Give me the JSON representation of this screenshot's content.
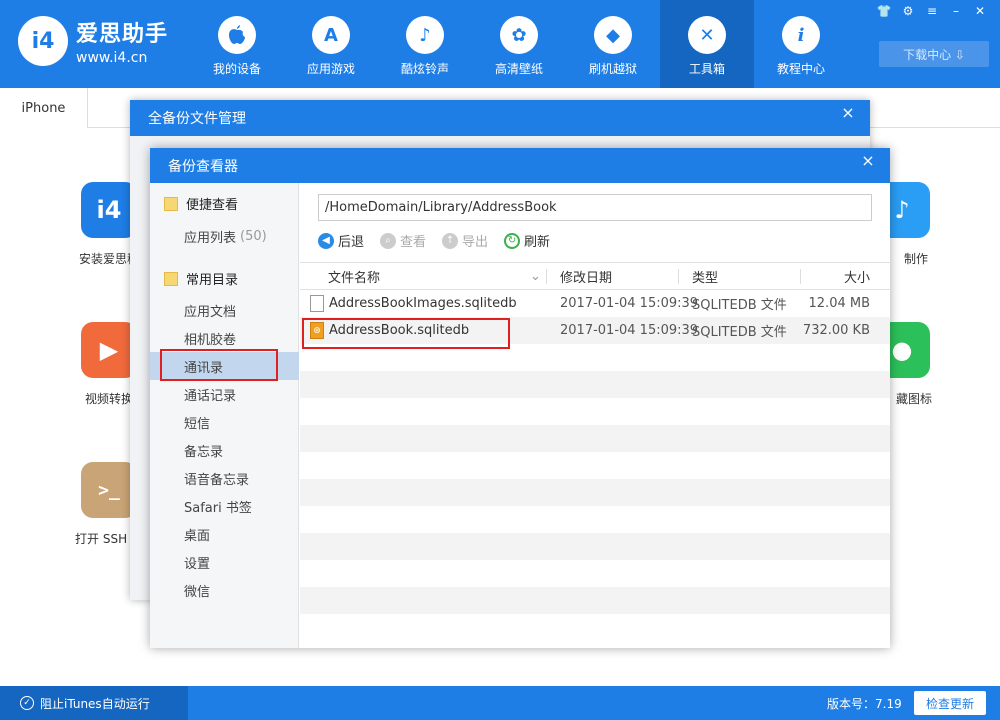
{
  "app": {
    "logo_mark": "i4",
    "logo_name": "爱思助手",
    "logo_url": "www.i4.cn"
  },
  "nav": [
    {
      "label": "我的设备",
      "icon": "apple-icon",
      "glyph": ""
    },
    {
      "label": "应用游戏",
      "icon": "appstore-icon",
      "glyph": "A"
    },
    {
      "label": "酷炫铃声",
      "icon": "bell-icon",
      "glyph": "♪"
    },
    {
      "label": "高清壁纸",
      "icon": "flower-icon",
      "glyph": "✿"
    },
    {
      "label": "刷机越狱",
      "icon": "box-icon",
      "glyph": "◆"
    },
    {
      "label": "工具箱",
      "icon": "tools-icon",
      "glyph": "✕"
    },
    {
      "label": "教程中心",
      "icon": "info-icon",
      "glyph": "i"
    }
  ],
  "download_center": "下载中心 ⇩",
  "device_tab": "iPhone",
  "tools": [
    {
      "label": "安装爱思移",
      "color": "#1e7ee6",
      "glyph": "i4"
    },
    {
      "label": "视频转换",
      "color": "#f06a3c",
      "glyph": "▶"
    },
    {
      "label": "打开 SSH 通",
      "color": "#c8a476",
      "glyph": ">_"
    },
    {
      "label": "制作",
      "color": "#2a9df4",
      "glyph": "♪"
    },
    {
      "label": "藏图标",
      "color": "#2cc05a",
      "glyph": "●"
    }
  ],
  "outer_dialog": {
    "title": "全备份文件管理",
    "close": "×"
  },
  "viewer": {
    "title": "备份查看器",
    "close": "×",
    "quick_group": "便捷查看",
    "app_list_label": "应用列表",
    "app_list_count": "(50)",
    "common_group": "常用目录",
    "items": [
      "应用文档",
      "相机胶卷",
      "通讯录",
      "通话记录",
      "短信",
      "备忘录",
      "语音备忘录",
      "Safari 书签",
      "桌面",
      "设置",
      "微信"
    ],
    "selected_item": "通讯录",
    "path": "/HomeDomain/Library/AddressBook",
    "toolbar": {
      "back": "后退",
      "view": "查看",
      "export": "导出",
      "refresh": "刷新"
    },
    "columns": {
      "name": "文件名称",
      "date": "修改日期",
      "type": "类型",
      "size": "大小"
    },
    "files": [
      {
        "name": "AddressBookImages.sqlitedb",
        "date": "2017-01-04 15:09:39",
        "type": "SQLITEDB 文件",
        "size": "12.04 MB",
        "icon": "file-icon"
      },
      {
        "name": "AddressBook.sqlitedb",
        "date": "2017-01-04 15:09:39",
        "type": "SQLITEDB 文件",
        "size": "732.00 KB",
        "icon": "database-file-icon"
      }
    ]
  },
  "status": {
    "block_itunes": "阻止iTunes自动运行",
    "version": "版本号：7.19",
    "check_update": "检查更新"
  }
}
